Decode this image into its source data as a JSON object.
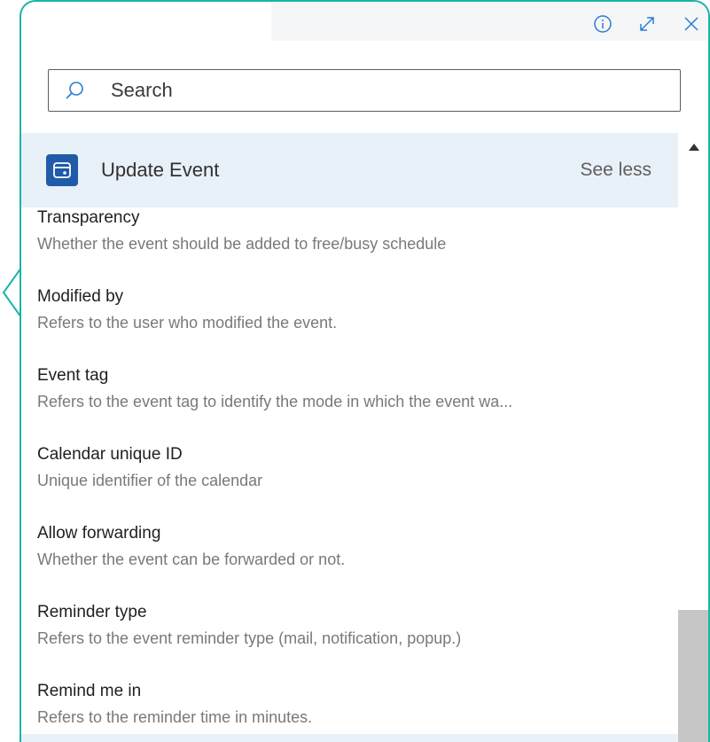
{
  "toolbar": {
    "info_icon": "info-icon",
    "expand_icon": "expand-icon",
    "close_icon": "close-icon"
  },
  "search": {
    "placeholder": "Search",
    "value": ""
  },
  "group": {
    "title": "Update Event",
    "toggle_label": "See less",
    "icon": "calendar-app-icon",
    "color": "#1f5ba8"
  },
  "items": [
    {
      "title": "Transparency",
      "description": "Whether the event should be added to free/busy schedule"
    },
    {
      "title": "Modified by",
      "description": "Refers to the user who modified the event."
    },
    {
      "title": "Event tag",
      "description": "Refers to the event tag to identify the mode in which the event wa..."
    },
    {
      "title": "Calendar unique ID",
      "description": "Unique identifier of the calendar"
    },
    {
      "title": "Allow forwarding",
      "description": "Whether the event can be forwarded or not."
    },
    {
      "title": "Reminder type",
      "description": "Refers to the event reminder type (mail, notification, popup.)"
    },
    {
      "title": "Remind me in",
      "description": "Refers to the reminder time in minutes."
    }
  ],
  "colors": {
    "border_accent": "#1ab4a6",
    "header_bg": "#e8f0f8"
  }
}
